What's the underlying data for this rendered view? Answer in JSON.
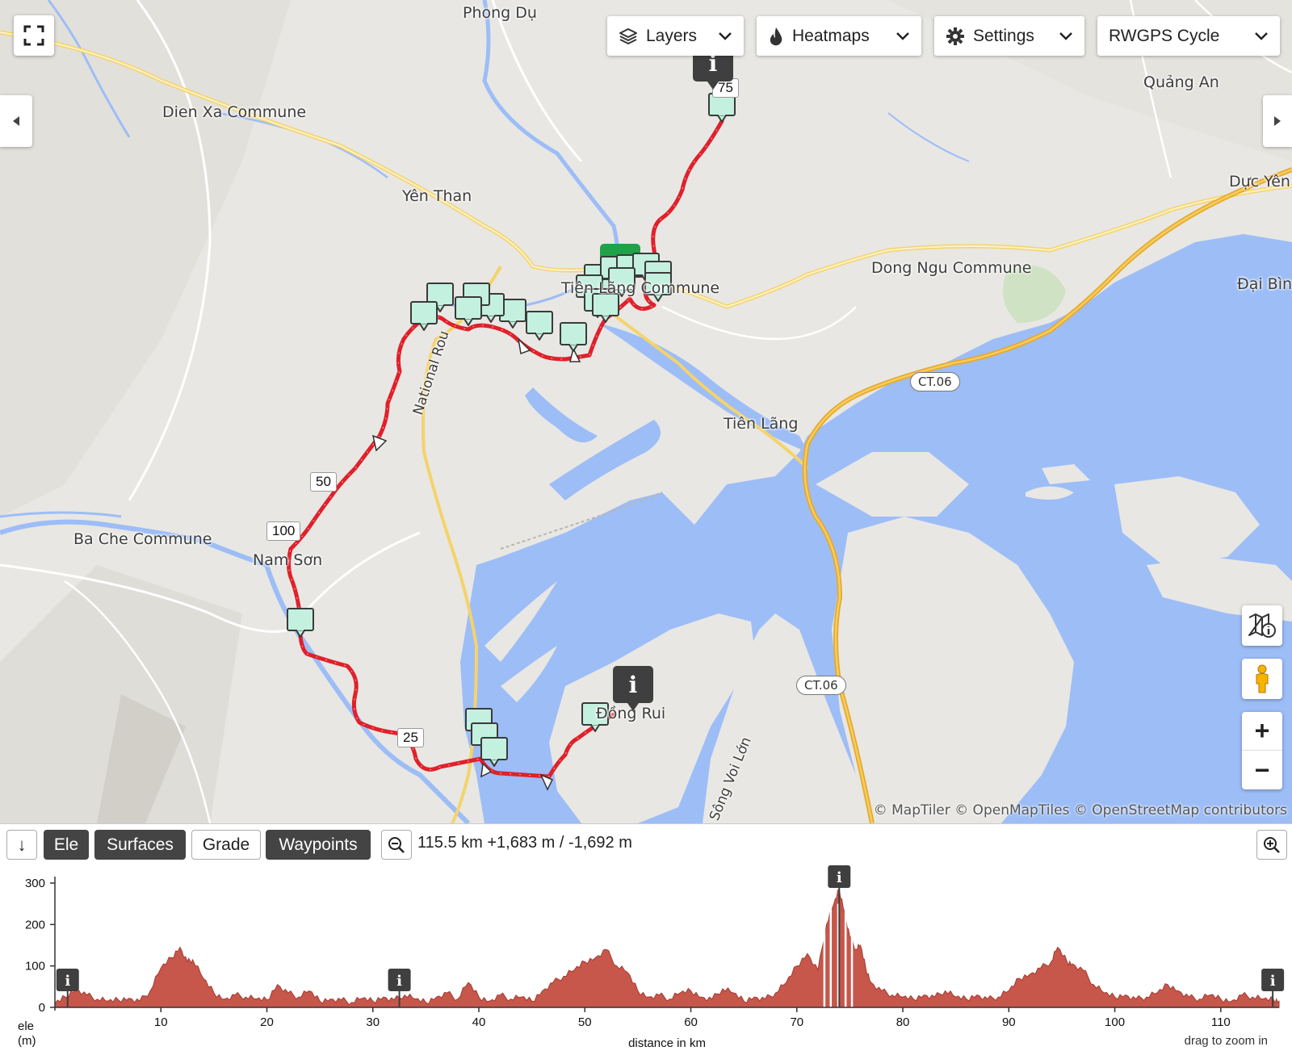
{
  "map": {
    "fullscreen_icon": "fullscreen-icon",
    "dropdowns": {
      "layers": {
        "label": "Layers",
        "icon": "layers-icon"
      },
      "heatmaps": {
        "label": "Heatmaps",
        "icon": "flame-icon"
      },
      "settings": {
        "label": "Settings",
        "icon": "gear-icon"
      },
      "basemap": {
        "label": "RWGPS Cycle"
      }
    },
    "places": {
      "phong_du": "Phong Dụ",
      "dien_xa": "Dien Xa Commune",
      "quang_an": "Quảng An",
      "yen_than": "Yên Than",
      "duc_yen": "Dực Yên",
      "dong_ngu": "Dong Ngu Commune",
      "dai_binh": "Đại Bìn",
      "tien_lang_commune": "Tiên Lãng Commune",
      "tien_lang": "Tiên Lãng",
      "ba_che": "Ba Che Commune",
      "nam_son": "Nam Sơn",
      "dong_rui": "Đồng Rui",
      "national_road": "National Rou",
      "song_voi_lon": "Sông Voi Lớn"
    },
    "road_shields": {
      "ct06_a": "CT.06",
      "ct06_b": "CT.06"
    },
    "km_markers": {
      "m75": "75",
      "m50": "50",
      "m100": "100",
      "m25": "25"
    },
    "info_pin_glyph": "i",
    "attribution": "© MapTiler © OpenMapTiles © OpenStreetMap contributors",
    "colors": {
      "route": "#e0202a",
      "water": "#9dbdf7",
      "land": "#e8e7e3",
      "waypoint": "#c3f0df",
      "start": "#1fa24a"
    },
    "controls": {
      "map_info_icon": "map-info-icon",
      "pegman_icon": "pegman-icon",
      "zoom_in": "+",
      "zoom_out": "−"
    }
  },
  "toolbar": {
    "collapse_icon": "arrow-down-icon",
    "collapse_glyph": "↓",
    "tabs": {
      "ele": "Ele",
      "surfaces": "Surfaces",
      "grade": "Grade",
      "waypoints": "Waypoints"
    },
    "zoom_out_icon": "magnifier-minus-icon",
    "zoom_in_icon": "magnifier-plus-icon",
    "stats": "115.5 km +1,683 m / -1,692 m"
  },
  "chart_data": {
    "type": "area",
    "title": "",
    "xlabel": "distance in km",
    "ylabel_line1": "ele",
    "ylabel_line2": "(m)",
    "hint": "drag to zoom in",
    "xlim": [
      0,
      115.5
    ],
    "ylim": [
      0,
      300
    ],
    "x_ticks": [
      10,
      20,
      30,
      40,
      50,
      60,
      70,
      80,
      90,
      100,
      110
    ],
    "y_ticks": [
      0,
      100,
      200,
      300
    ],
    "fill_color": "#c7574b",
    "info_markers_km": [
      1.2,
      32.5,
      74,
      114.9
    ],
    "x": [
      0,
      1,
      2,
      3,
      4,
      5,
      6,
      7,
      8,
      9,
      10,
      11,
      11.8,
      12.5,
      13,
      14,
      15,
      16,
      17,
      18,
      19,
      20,
      21,
      22,
      23,
      24,
      25,
      26,
      27,
      28,
      29,
      30,
      31,
      32,
      33,
      34,
      35,
      36,
      37,
      38,
      39,
      40,
      41,
      42,
      43,
      44,
      45,
      46,
      47,
      48,
      49,
      50,
      51,
      52,
      53,
      54,
      55,
      56,
      57,
      58,
      59,
      60,
      61,
      62,
      63,
      64,
      65,
      66,
      67,
      68,
      69,
      70,
      71,
      72,
      72.8,
      73.5,
      74,
      74.5,
      75,
      75.6,
      76,
      76.5,
      77,
      78,
      79,
      80,
      81,
      82,
      83,
      84,
      85,
      86,
      87,
      88,
      89,
      90,
      91,
      92,
      93,
      94,
      94.6,
      95.5,
      96,
      97,
      98,
      99,
      100,
      101,
      102,
      103,
      104,
      105,
      106,
      107,
      108,
      109,
      110,
      111,
      112,
      113,
      114,
      115,
      115.5
    ],
    "y": [
      10,
      25,
      45,
      30,
      20,
      15,
      18,
      22,
      15,
      40,
      95,
      120,
      145,
      110,
      115,
      70,
      35,
      20,
      30,
      25,
      20,
      18,
      55,
      35,
      25,
      40,
      15,
      20,
      18,
      12,
      22,
      15,
      25,
      18,
      30,
      20,
      12,
      25,
      35,
      20,
      60,
      25,
      15,
      30,
      20,
      25,
      15,
      40,
      60,
      75,
      90,
      110,
      120,
      140,
      100,
      85,
      40,
      25,
      30,
      20,
      35,
      40,
      25,
      20,
      45,
      35,
      15,
      25,
      20,
      35,
      60,
      100,
      130,
      90,
      200,
      250,
      285,
      230,
      170,
      140,
      150,
      95,
      60,
      40,
      30,
      25,
      20,
      30,
      25,
      40,
      25,
      20,
      30,
      20,
      25,
      40,
      70,
      80,
      95,
      110,
      145,
      110,
      105,
      90,
      55,
      35,
      25,
      30,
      20,
      25,
      35,
      55,
      40,
      25,
      20,
      30,
      20,
      15,
      30,
      25,
      20,
      18,
      15,
      18,
      15
    ]
  }
}
